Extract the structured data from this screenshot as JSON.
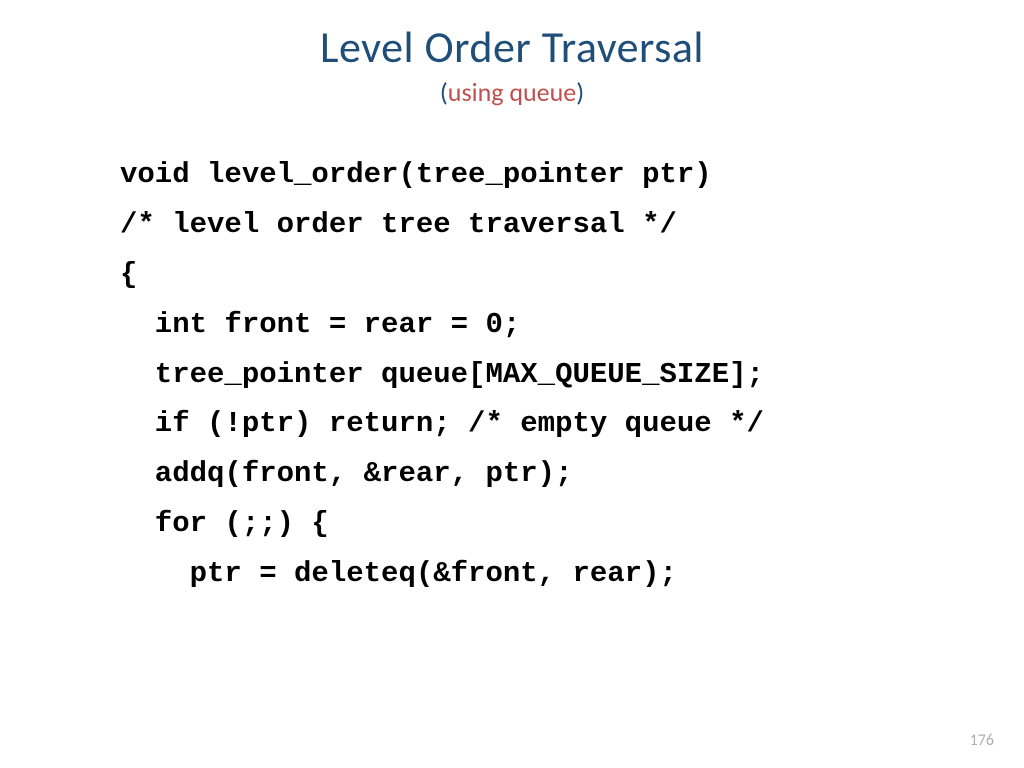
{
  "title": "Level Order Traversal",
  "subtitle_paren_open": "(",
  "subtitle_text": "using queue",
  "subtitle_paren_close": ")",
  "code": {
    "l1": "void level_order(tree_pointer ptr)",
    "l2": "/* level order tree traversal */",
    "l3": "{",
    "l4": "  int front = rear = 0;",
    "l5": "  tree_pointer queue[MAX_QUEUE_SIZE];",
    "l6": "  if (!ptr) return; /* empty queue */",
    "l7": "  addq(front, &rear, ptr);",
    "l8": "  for (;;) {",
    "l9": "    ptr = deleteq(&front, rear);"
  },
  "page_number": "176"
}
